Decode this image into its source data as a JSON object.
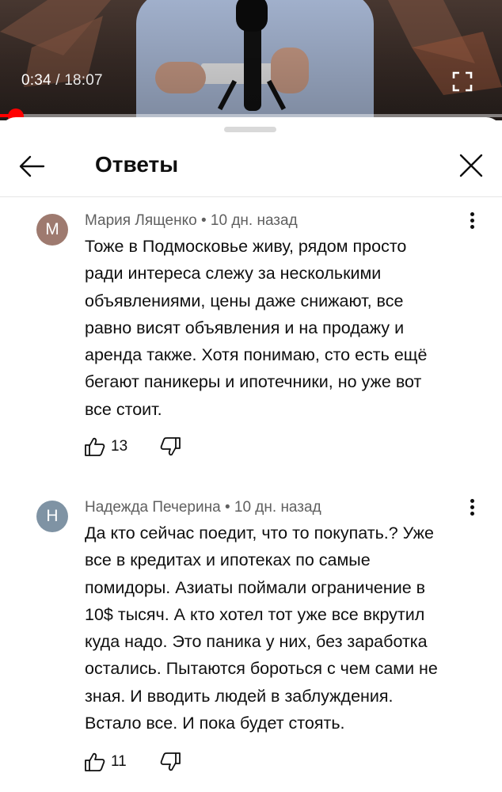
{
  "video": {
    "current_time": "0:34",
    "separator": " / ",
    "duration": "18:07",
    "progress_fraction": 0.031
  },
  "header": {
    "title": "Ответы"
  },
  "comments": [
    {
      "avatar_letter": "М",
      "avatar_color": "#9e7a6f",
      "author": "Мария Лященко",
      "age": "10 дн. назад",
      "text": "Тоже в Подмосковье живу, рядом просто\nради интереса слежу за несколькими\nобъявлениями, цены даже снижают, все\nравно висят объявления и на продажу и\nаренда также. Хотя понимаю, сто есть ещё\nбегают паникеры и ипотечники, но уже вот\nвсе стоит.",
      "likes": "13"
    },
    {
      "avatar_letter": "Н",
      "avatar_color": "#7f93a4",
      "author": "Надежда Печерина",
      "age": "10 дн. назад",
      "text": "Да кто сейчас поедит, что то покупать.?  Уже\nвсе в кредитах и ипотеках по самые\nпомидоры. Азиаты поймали ограничение в\n10$ тысяч.  А кто хотел тот уже все вкрутил\nкуда надо. Это паника у них, без заработка\nостались. Пытаются бороться  с чем сами не\nзная. И вводить людей в заблуждения.\nВстало все.  И пока будет стоять.",
      "likes": "11"
    }
  ],
  "meta_separator": " • ",
  "icons": {
    "back": "arrow-left-icon",
    "close": "close-icon",
    "more": "more-vert-icon",
    "like": "thumbs-up-icon",
    "dislike": "thumbs-down-icon",
    "fullscreen": "fullscreen-icon"
  }
}
